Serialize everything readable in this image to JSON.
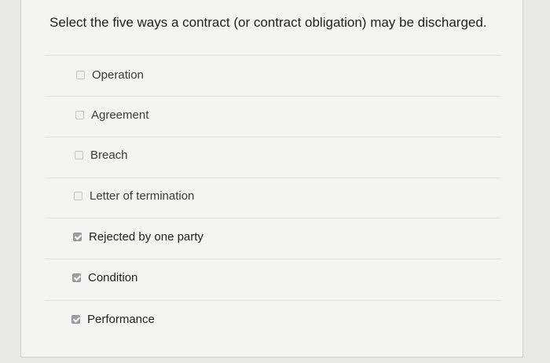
{
  "question": {
    "text": "Select the five ways a contract (or contract obligation) may be discharged."
  },
  "options": [
    {
      "label": "Operation",
      "checked": false
    },
    {
      "label": "Agreement",
      "checked": false
    },
    {
      "label": "Breach",
      "checked": false
    },
    {
      "label": "Letter of termination",
      "checked": false
    },
    {
      "label": "Rejected by one party",
      "checked": true
    },
    {
      "label": "Condition",
      "checked": true
    },
    {
      "label": "Performance",
      "checked": true
    }
  ]
}
